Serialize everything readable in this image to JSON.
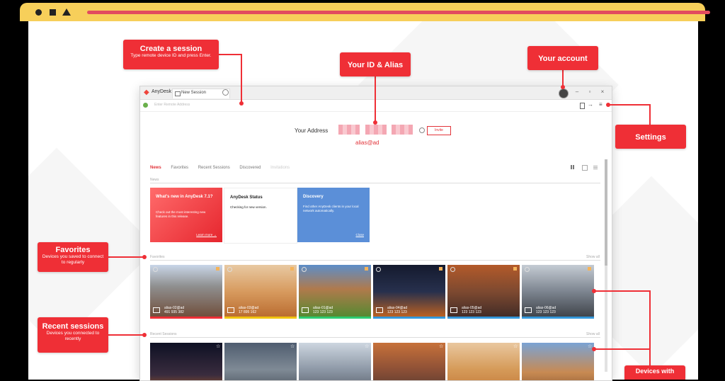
{
  "colors": {
    "accent": "#ef2f36",
    "chrome": "#f7cf5a",
    "chrome_bar": "#e24b5f"
  },
  "window": {
    "brand": "AnyDesk",
    "tab_label": "New Session",
    "address_placeholder": "Enter Remote Address",
    "your_address_label": "Your Address",
    "alias": "alias@ad",
    "invite_label": "Invite",
    "nav_tabs": [
      "News",
      "Favorites",
      "Recent Sessions",
      "Discovered",
      "Invitations"
    ],
    "news_label": "News",
    "favorites_label": "Favorites",
    "recent_label": "Recent Sessions",
    "show_all": "Show all",
    "cards": [
      {
        "title": "What's new in AnyDesk 7.1?",
        "text": "Check out the most interesting new features in this release.",
        "link": "Learn more →"
      },
      {
        "title": "AnyDesk Status",
        "text": "Checking for new version.",
        "link": ""
      },
      {
        "title": "Discovery",
        "text": "Find other AnyDesk clients in your local network automatically.",
        "link": "Close"
      }
    ],
    "favorites": [
      {
        "name": "alias-02@ad",
        "id": "491 935 382"
      },
      {
        "name": "alias-03@ad",
        "id": "17 895 162"
      },
      {
        "name": "alias-01@ad",
        "id": "123 123 123"
      },
      {
        "name": "alias-04@ad",
        "id": "123 123 123"
      },
      {
        "name": "alias-05@ad",
        "id": "123 123 123"
      },
      {
        "name": "alias-06@ad",
        "id": "123 123 123"
      }
    ]
  },
  "callouts": {
    "create_session": {
      "title": "Create a session",
      "sub": "Type remote device ID and press Enter."
    },
    "your_id": {
      "title": "Your ID & Alias"
    },
    "your_account": {
      "title": "Your account"
    },
    "settings": {
      "title": "Settings"
    },
    "favorites": {
      "title": "Favorites",
      "sub": "Devices you saved to connect to regularly"
    },
    "recent": {
      "title": "Recent sessions",
      "sub": "Devices you connected to recently"
    },
    "devices": {
      "title": "Devices with"
    }
  }
}
